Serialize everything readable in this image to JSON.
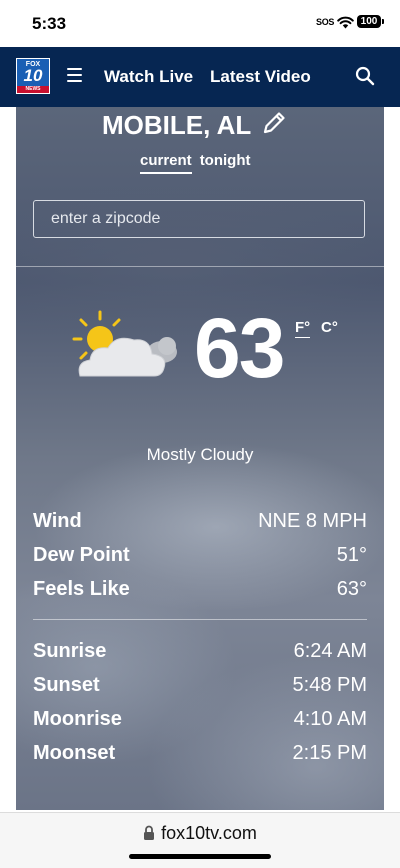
{
  "status_bar": {
    "time": "5:33",
    "sos": "SOS",
    "battery": "100"
  },
  "nav": {
    "logo_fox": "FOX",
    "logo_number": "10",
    "logo_news": "NEWS",
    "links": [
      "Watch Live",
      "Latest Video"
    ],
    "menu_icon": "hamburger-icon",
    "search_icon": "search-icon",
    "bg_color": "#062652"
  },
  "weather": {
    "city": "MOBILE, AL",
    "tabs": [
      {
        "label": "current",
        "active": true
      },
      {
        "label": "tonight",
        "active": false
      }
    ],
    "zip_placeholder": "enter a zipcode",
    "zip_value": "",
    "icon": "partly-sunny-cloud-icon",
    "temperature": "63",
    "unit_f": "F°",
    "unit_c": "C°",
    "active_unit": "F",
    "condition": "Mostly Cloudy",
    "details": [
      {
        "label": "Wind",
        "value": "NNE 8 MPH"
      },
      {
        "label": "Dew Point",
        "value": "51°"
      },
      {
        "label": "Feels Like",
        "value": "63°"
      }
    ],
    "astro": [
      {
        "label": "Sunrise",
        "value": "6:24 AM"
      },
      {
        "label": "Sunset",
        "value": "5:48 PM"
      },
      {
        "label": "Moonrise",
        "value": "4:10 AM"
      },
      {
        "label": "Moonset",
        "value": "2:15 PM"
      }
    ]
  },
  "browser": {
    "url": "fox10tv.com"
  }
}
